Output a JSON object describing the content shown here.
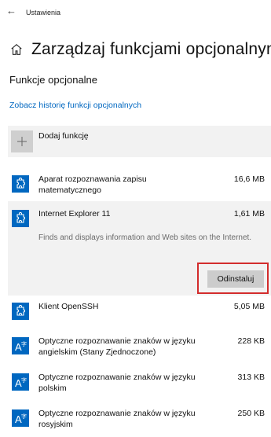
{
  "window": {
    "title": "Ustawienia",
    "back_icon": "←"
  },
  "page": {
    "title": "Zarządzaj funkcjami opcjonalnymi"
  },
  "section": {
    "title": "Funkcje opcjonalne",
    "history_link": "Zobacz historię funkcji opcjonalnych",
    "add_feature": "Dodaj funkcję"
  },
  "features": [
    {
      "name": "Aparat rozpoznawania zapisu matematycznego",
      "size": "16,6 MB",
      "icon": "puzzle-icon"
    },
    {
      "name": "Internet Explorer 11",
      "size": "1,61 MB",
      "icon": "puzzle-icon",
      "description": "Finds and displays information and Web sites on the Internet.",
      "button": "Odinstaluj"
    },
    {
      "name": "Klient OpenSSH",
      "size": "5,05 MB",
      "icon": "puzzle-icon"
    },
    {
      "name": "Optyczne rozpoznawanie znaków w języku angielskim (Stany Zjednoczone)",
      "size": "228 KB",
      "icon": "ocr-icon"
    },
    {
      "name": "Optyczne rozpoznawanie znaków w języku polskim",
      "size": "313 KB",
      "icon": "ocr-icon"
    },
    {
      "name": "Optyczne rozpoznawanie znaków w języku rosyjskim",
      "size": "250 KB",
      "icon": "ocr-icon"
    }
  ],
  "colors": {
    "accent": "#0067c0",
    "highlight": "#d32c2c",
    "expanded_bg": "#f2f2f2"
  }
}
